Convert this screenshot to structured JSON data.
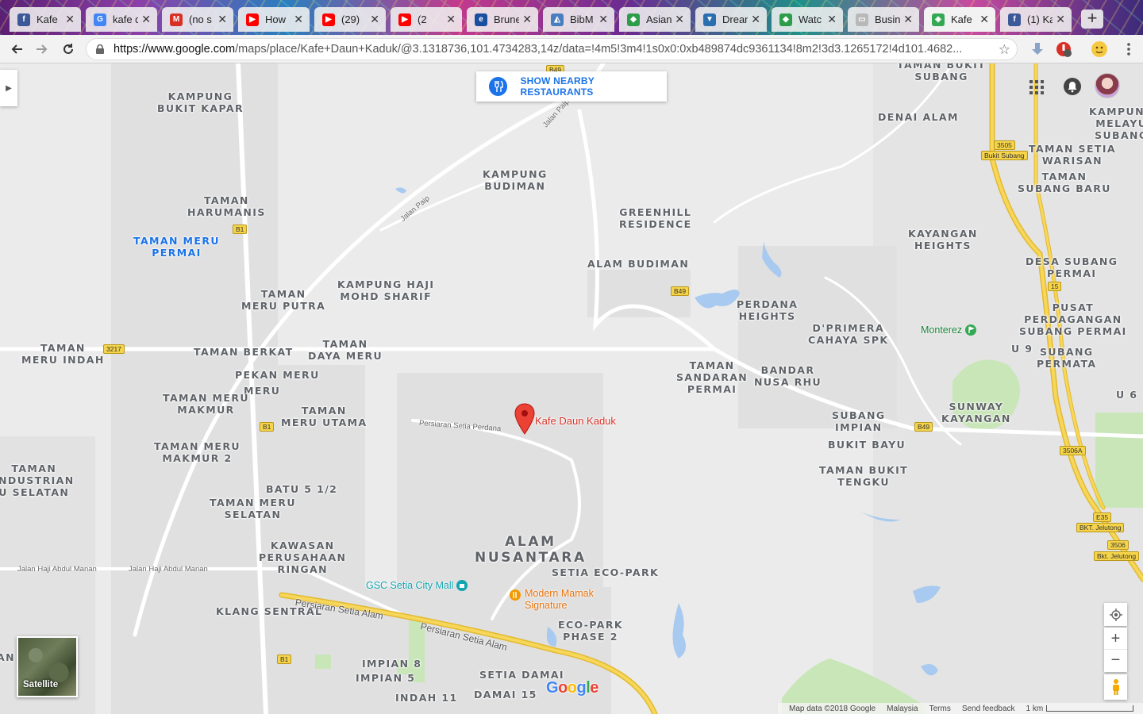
{
  "tabs": [
    {
      "title": "Kafe",
      "fav": "f",
      "favColor": "#3b5998"
    },
    {
      "title": "kafe d",
      "fav": "G",
      "favColor": "#4285f4"
    },
    {
      "title": "(no s",
      "fav": "M",
      "favColor": "#d93025"
    },
    {
      "title": "How",
      "fav": "▶",
      "favColor": "#ff0000"
    },
    {
      "title": "(29)",
      "fav": "▶",
      "favColor": "#ff0000"
    },
    {
      "title": "(2",
      "fav": "▶",
      "favColor": "#ff0000"
    },
    {
      "title": "Brune",
      "fav": "e",
      "favColor": "#1a4fa0"
    },
    {
      "title": "BibM",
      "fav": "◭",
      "favColor": "#4a7fbf"
    },
    {
      "title": "Asian",
      "fav": "◆",
      "favColor": "#2e9d49"
    },
    {
      "title": "Dream",
      "fav": "▼",
      "favColor": "#2a6fb0"
    },
    {
      "title": "Watc",
      "fav": "◆",
      "favColor": "#2e9d49"
    },
    {
      "title": "Busin",
      "fav": "▭",
      "favColor": "#b8b8b8"
    },
    {
      "title": "Kafe",
      "fav": "◈",
      "favColor": "#34a853"
    },
    {
      "title": "(1) Ka",
      "fav": "f",
      "favColor": "#3b5998"
    }
  ],
  "toolbar": {
    "url_host": "https://www.google.com",
    "url_path": "/maps/place/Kafe+Daun+Kaduk/@3.1318736,101.4734283,14z/data=!4m5!3m4!1s0x0:0xb489874dc9361134!8m2!3d3.1265172!4d101.4682..."
  },
  "map": {
    "place_name": "Kafe Daun Kaduk",
    "nearby_button": "SHOW NEARBY RESTAURANTS",
    "satellite_label": "Satellite",
    "google": "Google",
    "footer": {
      "map_data": "Map data ©2018 Google",
      "region": "Malaysia",
      "terms": "Terms",
      "feedback": "Send feedback",
      "scale": "1 km"
    },
    "areas": [
      {
        "t": "KAMPUNG\nBUKIT KAPAR"
      },
      {
        "t": "TAMAN\nHARUMANIS"
      },
      {
        "t": "TAMAN MERU\nPERMAI"
      },
      {
        "t": "KAMPUNG\nBUDIMAN"
      },
      {
        "t": "GREENHILL\nRESIDENCE"
      },
      {
        "t": "ALAM BUDIMAN"
      },
      {
        "t": "DENAI ALAM"
      },
      {
        "t": "TAMAN BUKIT\nSUBANG"
      },
      {
        "t": "KAMPUNG\nMELAYU\nSUBANG"
      },
      {
        "t": "TAMAN SETIA\nWARISAN"
      },
      {
        "t": "TAMAN\nSUBANG BARU"
      },
      {
        "t": "KAYANGAN\nHEIGHTS"
      },
      {
        "t": "DESA SUBANG\nPERMAI"
      },
      {
        "t": "PUSAT\nPERDAGANGAN\nSUBANG PERMAI"
      },
      {
        "t": "SUBANG\nPERMATA"
      },
      {
        "t": "U 9"
      },
      {
        "t": "U 6"
      },
      {
        "t": "TAMAN\nMERU PUTRA"
      },
      {
        "t": "KAMPUNG HAJI\nMOHD SHARIF"
      },
      {
        "t": "PERDANA\nHEIGHTS"
      },
      {
        "t": "D'PRIMERA\nCAHAYA SPK"
      },
      {
        "t": "TAMAN\nMERU INDAH"
      },
      {
        "t": "TAMAN BERKAT"
      },
      {
        "t": "TAMAN\nDAYA MERU"
      },
      {
        "t": "PEKAN MERU"
      },
      {
        "t": "MERU"
      },
      {
        "t": "TAMAN MERU\nMAKMUR"
      },
      {
        "t": "TAMAN\nMERU UTAMA"
      },
      {
        "t": "TAMAN\nSANDARAN\nPERMAI"
      },
      {
        "t": "BANDAR\nNUSA RHU"
      },
      {
        "t": "SUNWAY\nKAYANGAN"
      },
      {
        "t": "SUBANG\nIMPIAN"
      },
      {
        "t": "BUKIT BAYU"
      },
      {
        "t": "TAMAN BUKIT\nTENGKU"
      },
      {
        "t": "TAMAN MERU\nMAKMUR 2"
      },
      {
        "t": "TAMAN\nINDUSTRIAN\nU SELATAN"
      },
      {
        "t": "BATU 5 1/2"
      },
      {
        "t": "TAMAN MERU\nSELATAN"
      },
      {
        "t": "KAWASAN\nPERUSAHAAN\nRINGAN"
      },
      {
        "t": "ALAM\nNUSANTARA"
      },
      {
        "t": "SETIA ECO-PARK"
      },
      {
        "t": "KLANG SENTRAL"
      },
      {
        "t": "ECO-PARK\nPHASE 2"
      },
      {
        "t": "IMPIAN 8"
      },
      {
        "t": "IMPIAN 5"
      },
      {
        "t": "SETIA DAMAI"
      },
      {
        "t": "INDAH 11"
      },
      {
        "t": "DAMAI 15"
      },
      {
        "t": "AN"
      }
    ],
    "roads": [
      {
        "t": "Jalan Paip"
      },
      {
        "t": "Jalan Paip"
      },
      {
        "t": "Persiaran Setia Perdana"
      },
      {
        "t": "Jalan Haji Abdul Manan"
      },
      {
        "t": "Jalan Haji Abdul Manan"
      },
      {
        "t": "Persiaran Setia Alam"
      },
      {
        "t": "Persiaran Setia Alam"
      }
    ],
    "shields": [
      "B49",
      "B1",
      "3217",
      "B1",
      "B49",
      "B49",
      "3505",
      "Bukit Subang",
      "15",
      "3506A",
      "E35",
      "BKT. Jelutong",
      "3506",
      "Bkt. Jelutong",
      "B1"
    ],
    "pois": [
      {
        "name": "Monterez",
        "color": "#188038"
      },
      {
        "name": "GSC Setia City Mall",
        "color": "#12a4af"
      },
      {
        "name": "Modern Mamak\nSignature",
        "color": "#e8710a"
      }
    ]
  }
}
